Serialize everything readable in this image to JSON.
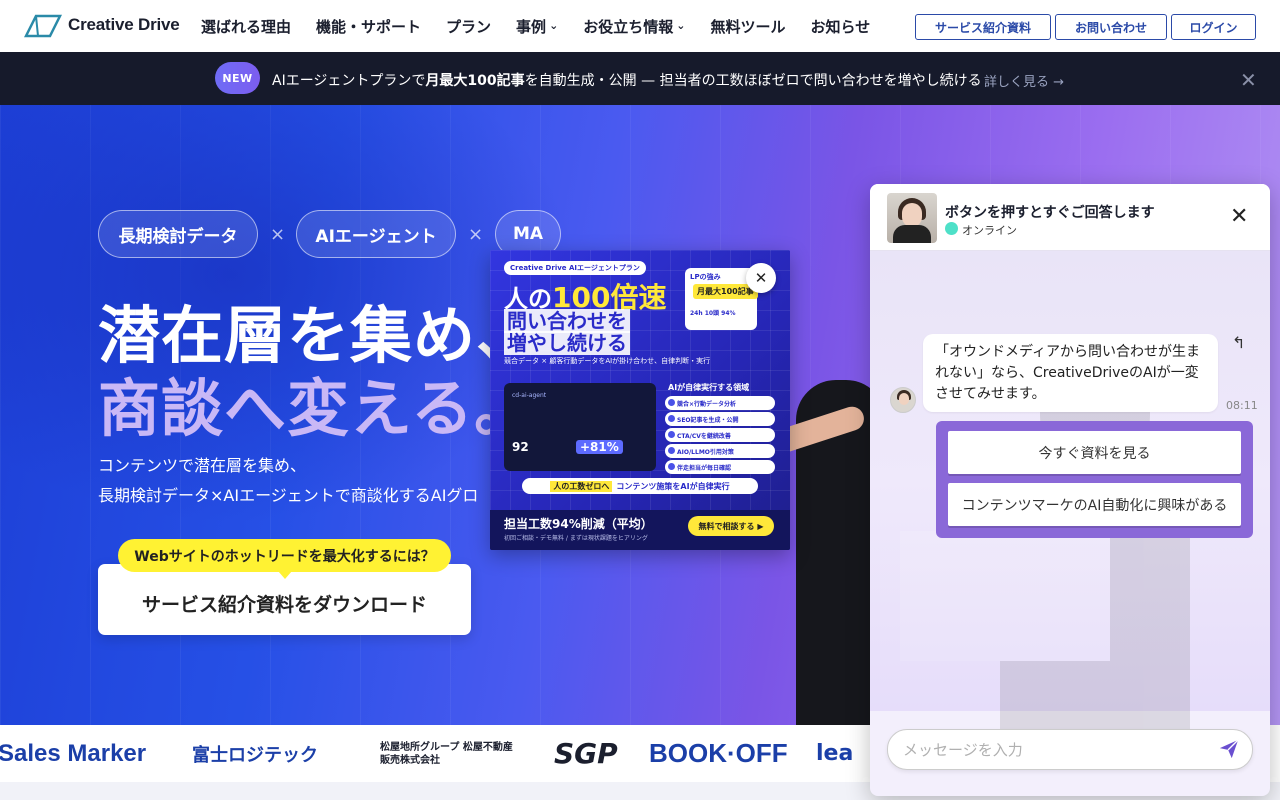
{
  "header": {
    "logo_text": "Creative Drive",
    "nav": [
      {
        "label": "選ばれる理由",
        "dropdown": false
      },
      {
        "label": "機能・サポート",
        "dropdown": false
      },
      {
        "label": "プラン",
        "dropdown": false
      },
      {
        "label": "事例",
        "dropdown": true
      },
      {
        "label": "お役立ち情報",
        "dropdown": true
      },
      {
        "label": "無料ツール",
        "dropdown": false
      },
      {
        "label": "お知らせ",
        "dropdown": false
      }
    ],
    "buttons": [
      "サービス紹介資料",
      "お問い合わせ",
      "ログイン"
    ]
  },
  "announcement": {
    "badge": "NEW",
    "text_pre": "AIエージェントプランで",
    "text_bold": "月最大100記事",
    "text_post": "を自動生成・公開 — 担当者の工数ほぼゼロで問い合わせを増やし続ける",
    "link": "詳しく見る →",
    "close": "✕"
  },
  "hero": {
    "pills": [
      "長期検討データ",
      "AIエージェント",
      "MA"
    ],
    "times": "×",
    "title_line1": "潜在層を集め、",
    "title_line2": "商談へ変える。",
    "sub_line1": "コンテンツで潜在層を集め、",
    "sub_line2": "長期検討データ×AIエージェントで商談化するAIグロ",
    "cta_bubble": "Webサイトのホットリードを最大化するには？",
    "cta_button": "サービス紹介資料をダウンロード"
  },
  "ad": {
    "tag": "Creative Drive AIエージェントプラン",
    "h1_pre": "人の",
    "h1_big": "100倍速",
    "h2_line1": "問い合わせを",
    "h2_line2": "増やし続ける",
    "small": "競合データ × 顧客行動データをAIが掛け合わせ、自律判断・実行",
    "lp_title": "LPの強み",
    "lp_pill": "月最大100記事",
    "lp_stats": "24h  10頭  94%",
    "dash_label": "cd-ai-agent",
    "kpi1": "92",
    "kpi2": "+81%",
    "list_title": "AIが自律実行する領域",
    "list": [
      "競合×行動データ分析",
      "SEO記事を生成・公開",
      "CTA/CVを継続改善",
      "AIO/LLMO引用対策",
      "伴走担当が毎日確認"
    ],
    "row_bold": "人の工数ゼロへ",
    "row_text": "コンテンツ施策をAIが自律実行",
    "foot_text": "担当工数94%削減（平均）",
    "foot_small": "初回ご相談・デモ無料 / まずは現状課題をヒアリング",
    "foot_btn": "無料で相談する ▶",
    "close": "✕"
  },
  "logos": [
    {
      "text": "Sales Marker",
      "color": "#1b3fa8"
    },
    {
      "text": "富士ロジテック",
      "color": "#1b3fa8"
    },
    {
      "text": "松屋地所グループ 松屋不動産販売株式会社",
      "color": "#1b1f2e"
    },
    {
      "text": "SGP",
      "color": "#1b1f2e"
    },
    {
      "text": "BOOK·OFF",
      "color": "#1b3fa8"
    },
    {
      "text": "lea",
      "color": "#1b3fa8"
    }
  ],
  "chat": {
    "title": "ボタンを押すとすぐご回答します",
    "status": "オンライン",
    "close": "✕",
    "message": "「オウンドメディアから問い合わせが生まれない」なら、CreativeDriveのAIが一変させてみせます。",
    "time": "08:11",
    "reply_icon": "↰",
    "choices": [
      "今すぐ資料を見る",
      "コンテンツマーケのAI自動化に興味がある"
    ],
    "input_placeholder": "メッセージを入力"
  },
  "colors": {
    "brand_blue": "#2b4aa8",
    "hero_from": "#1d3fd6",
    "hero_to": "#b395f3",
    "chat_accent": "#8a68d8",
    "yellow": "#fff233"
  }
}
